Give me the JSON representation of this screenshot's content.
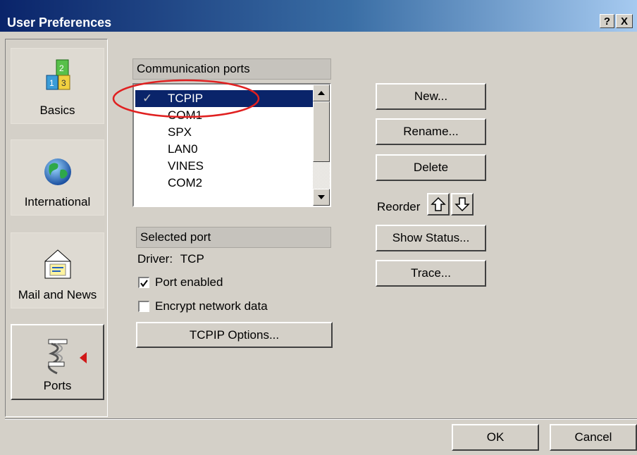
{
  "window": {
    "title": "User Preferences",
    "help_button": "?",
    "close_button": "X"
  },
  "sidebar": {
    "items": [
      {
        "label": "Basics",
        "icon": "blocks-icon"
      },
      {
        "label": "International",
        "icon": "globe-icon"
      },
      {
        "label": "Mail and News",
        "icon": "letter-icon"
      },
      {
        "label": "Ports",
        "icon": "cable-icon",
        "active": true
      }
    ]
  },
  "ports": {
    "header": "Communication ports",
    "list": [
      {
        "name": "TCPIP",
        "selected": true,
        "checked": true
      },
      {
        "name": "COM1"
      },
      {
        "name": "SPX"
      },
      {
        "name": "LAN0"
      },
      {
        "name": "VINES"
      },
      {
        "name": "COM2"
      }
    ],
    "annotation_color": "#e02020"
  },
  "selected_port": {
    "header": "Selected port",
    "driver_label": "Driver:",
    "driver_value": "TCP",
    "port_enabled_label": "Port enabled",
    "port_enabled": true,
    "encrypt_label": "Encrypt network data",
    "encrypt": false,
    "options_button": "TCPIP Options..."
  },
  "actions": {
    "new_button": "New...",
    "rename_button": "Rename...",
    "delete_button": "Delete",
    "reorder_label": "Reorder",
    "show_status_button": "Show Status...",
    "trace_button": "Trace..."
  },
  "footer": {
    "ok_button": "OK",
    "cancel_button": "Cancel"
  }
}
